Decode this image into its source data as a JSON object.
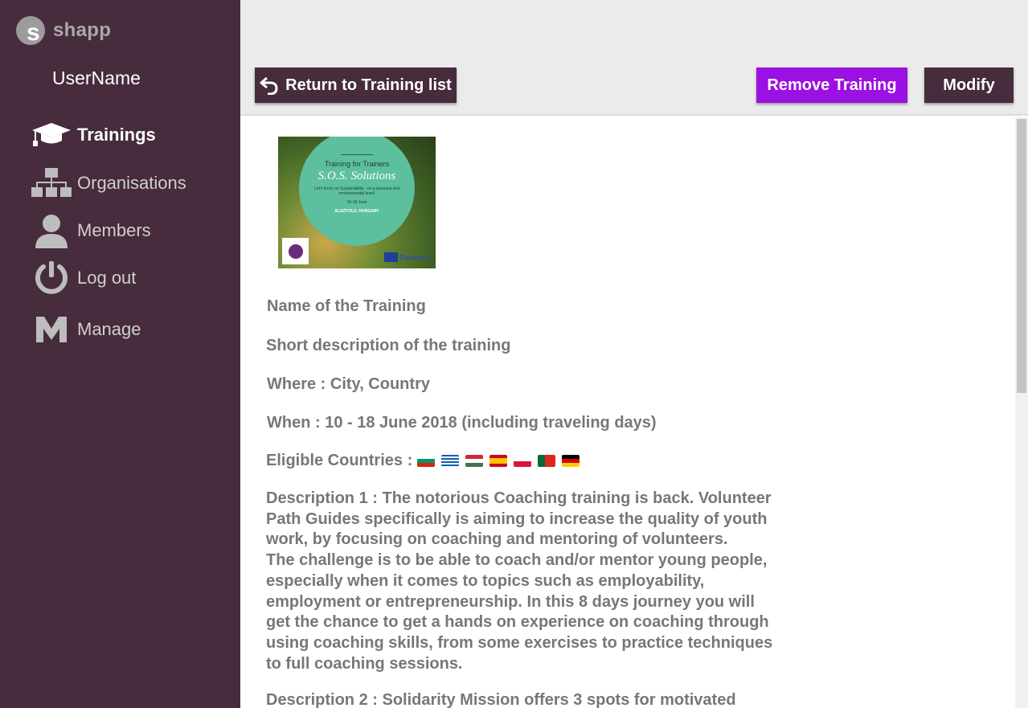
{
  "app": {
    "logo_letter": "s",
    "logo_text": "shapp"
  },
  "user": {
    "name": "UserName"
  },
  "sidebar": {
    "items": [
      {
        "label": "Trainings",
        "icon": "graduation-cap-icon",
        "active": true
      },
      {
        "label": "Organisations",
        "icon": "org-chart-icon",
        "active": false
      },
      {
        "label": "Members",
        "icon": "user-icon",
        "active": false
      },
      {
        "label": "Log out",
        "icon": "power-icon",
        "active": false
      },
      {
        "label": "Manage",
        "icon": "manage-m-icon",
        "active": false
      }
    ]
  },
  "toolbar": {
    "return_label": "Return to Training list",
    "remove_label": "Remove Training",
    "modify_label": "Modify"
  },
  "poster": {
    "heading": "Training for Trainers",
    "title": "S.O.S. Solutions",
    "subtitle": "Let's focus on Sustainability - on a personal and environmental level!",
    "dates": "10-18 June",
    "place": "ALSÓTOLD, HUNGARY",
    "partner": "Erasmus+"
  },
  "training": {
    "name": "Name of the Training",
    "short_description": "Short description of the training",
    "where": "Where : City, Country",
    "when": "When : 10 - 18 June 2018 (including traveling days)",
    "eligible_label": "Eligible Countries :",
    "countries": [
      "Bulgaria",
      "Greece",
      "Hungary",
      "Spain",
      "Poland",
      "Portugal",
      "Germany"
    ],
    "description_1": "Description 1 : The notorious Coaching training is back. Volunteer\nPath Guides specifically is aiming to increase the quality of youth\nwork, by focusing on coaching and mentoring of volunteers.\nThe challenge is to be able to coach and/or mentor young people,\nespecially when it comes to topics such as employability,\nemployment or entrepreneurship. In this 8 days journey you will\nget the chance to get a hands on experience on coaching through\nusing coaching skills, from some exercises to practice techniques\nto full coaching sessions.",
    "description_2": "Description 2 : Solidarity Mission offers 3 spots for motivated"
  },
  "colors": {
    "sidebar_bg": "#462c3c",
    "remove_button": "#9b10e3",
    "topbar_bg": "#ebebeb",
    "text_grey": "#777777"
  }
}
